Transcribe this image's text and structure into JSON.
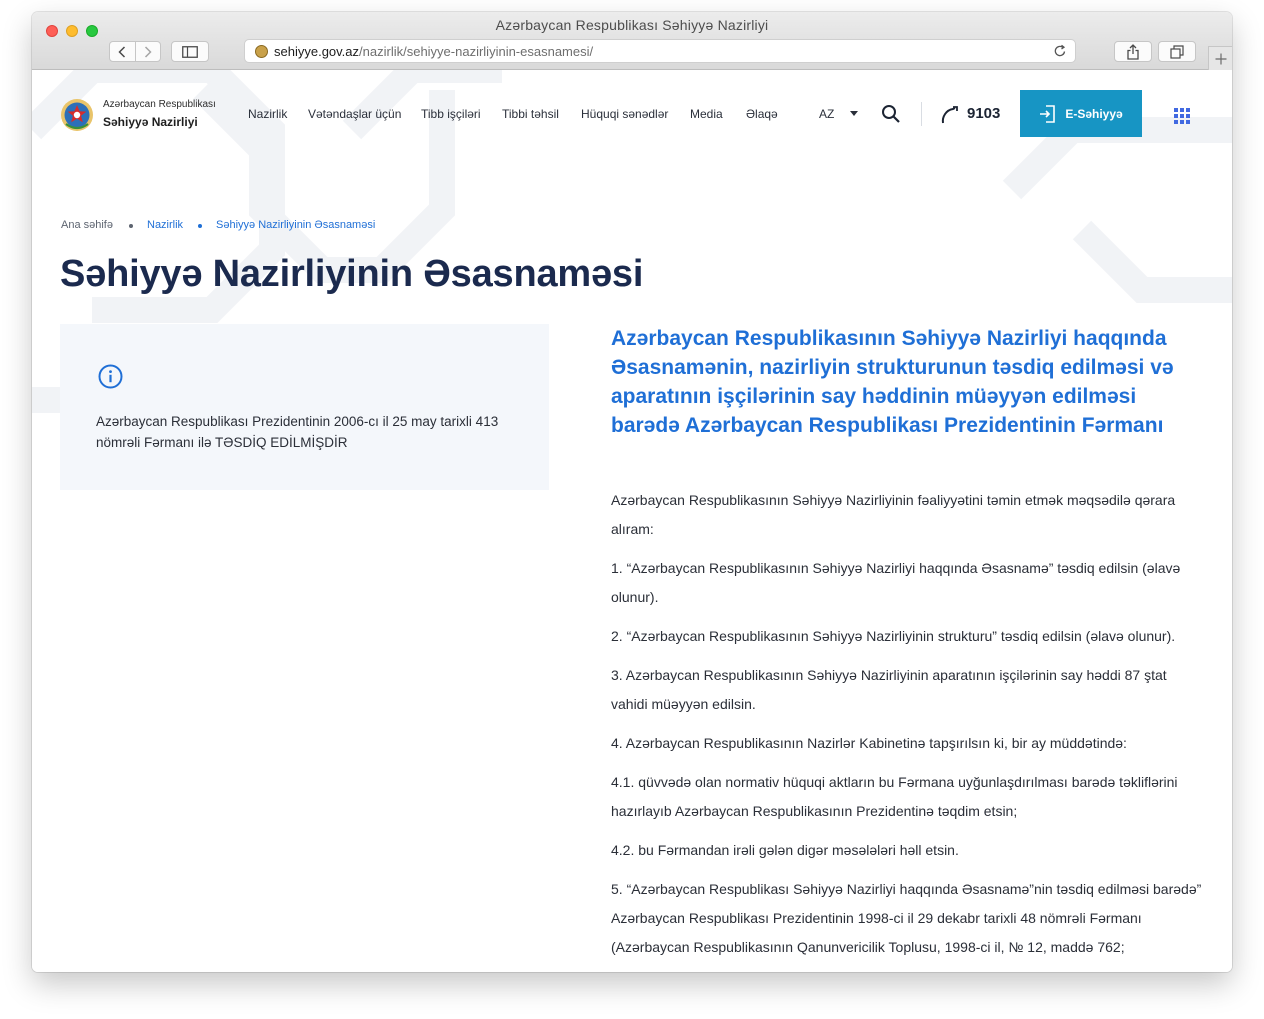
{
  "browser": {
    "window_title": "Azərbaycan Respublikası Səhiyyə Nazirliyi",
    "url_domain": "sehiyye.gov.az",
    "url_path": "/nazirlik/sehiyye-nazirliyinin-esasnamesi/"
  },
  "header": {
    "logo_line1": "Azərbaycan Respublikası",
    "logo_line2": "Səhiyyə Nazirliyi",
    "nav": [
      "Nazirlik",
      "Vətəndaşlar üçün",
      "Tibb işçiləri",
      "Tibbi təhsil",
      "Hüquqi sənədlər",
      "Media",
      "Əlaqə"
    ],
    "language": "AZ",
    "phone": "9103",
    "e_button": "E-Səhiyyə"
  },
  "breadcrumb": [
    "Ana səhifə",
    "Nazirlik",
    "Səhiyyə Nazirliyinin Əsasnaməsi"
  ],
  "page_title": "Səhiyyə Nazirliyinin Əsasnaməsi",
  "info_box": {
    "text": "Azərbaycan Respublikası Prezidentinin 2006-cı il 25 may tarixli 413 nömrəli Fərmanı ilə TƏSDİQ EDİLMİŞDİR"
  },
  "decree_title": "Azərbaycan Respublikasının Səhiyyə Nazirliyi haqqında Əsasnamənin, nazirliyin strukturunun təsdiq edilməsi və aparatının işçilərinin say həddinin müəyyən edilməsi barədə Azərbaycan Respublikası Prezidentinin Fərmanı",
  "paragraphs": [
    "Azərbaycan Respublikasının Səhiyyə Nazirliyinin fəaliyyətini təmin etmək məqsədilə qərara alıram:",
    "1. “Azərbaycan Respublikasının Səhiyyə Nazirliyi haqqında Əsasnamə” təsdiq edilsin (əlavə olunur).",
    "2. “Azərbaycan Respublikasının Səhiyyə Nazirliyinin strukturu” təsdiq edilsin (əlavə olunur).",
    "3. Azərbaycan Respublikasının Səhiyyə Nazirliyinin aparatının işçilərinin say həddi 87 ştat vahidi müəyyən edilsin.",
    "4. Azərbaycan Respublikasının Nazirlər Kabinetinə tapşırılsın ki, bir ay müddətində:",
    "4.1. qüvvədə olan normativ hüquqi aktların bu Fərmana uyğunlaşdırılması barədə təkliflərini hazırlayıb Azərbaycan Respublikasının Prezidentinə təqdim etsin;",
    "4.2. bu Fərmandan irəli gələn digər məsələləri həll etsin.",
    "5. “Azərbaycan Respublikası Səhiyyə Nazirliyi haqqında Əsasnamə”nin təsdiq edilməsi barədə” Azərbaycan Respublikası Prezidentinin 1998-ci il 29 dekabr tarixli 48 nömrəli Fərmanı (Azərbaycan Respublikasının Qanunvericilik Toplusu, 1998-ci il, № 12, maddə 762;"
  ],
  "colors": {
    "primary_blue": "#1f6fd6",
    "button_teal": "#1795c4",
    "title_navy": "#1b2a4e",
    "info_bg": "#f4f7fb"
  }
}
